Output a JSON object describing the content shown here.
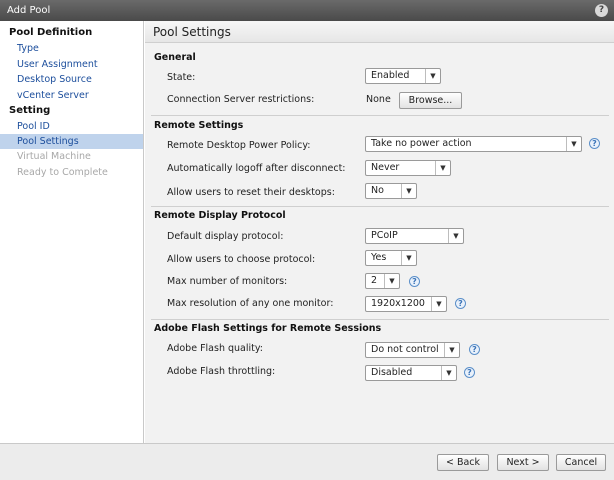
{
  "window": {
    "title": "Add Pool",
    "help": "?"
  },
  "sidebar": {
    "group1": "Pool Definition",
    "items1": [
      "Type",
      "User Assignment",
      "Desktop Source",
      "vCenter Server"
    ],
    "group2": "Setting",
    "items2": [
      "Pool ID",
      "Pool Settings",
      "Virtual Machine",
      "Ready to Complete"
    ]
  },
  "main": {
    "header": "Pool Settings",
    "general": {
      "title": "General",
      "state_label": "State:",
      "state_value": "Enabled",
      "conn_label": "Connection Server restrictions:",
      "conn_value": "None",
      "browse": "Browse..."
    },
    "remote": {
      "title": "Remote Settings",
      "power_label": "Remote Desktop Power Policy:",
      "power_value": "Take no power action",
      "logoff_label": "Automatically logoff after disconnect:",
      "logoff_value": "Never",
      "reset_label": "Allow users to reset their desktops:",
      "reset_value": "No"
    },
    "display": {
      "title": "Remote Display Protocol",
      "default_label": "Default display protocol:",
      "default_value": "PCoIP",
      "choose_label": "Allow users to choose protocol:",
      "choose_value": "Yes",
      "monitors_label": "Max number of monitors:",
      "monitors_value": "2",
      "resolution_label": "Max resolution of any one monitor:",
      "resolution_value": "1920x1200"
    },
    "flash": {
      "title": "Adobe Flash Settings for Remote Sessions",
      "quality_label": "Adobe Flash quality:",
      "quality_value": "Do not control",
      "throttle_label": "Adobe Flash throttling:",
      "throttle_value": "Disabled"
    }
  },
  "footer": {
    "back": "< Back",
    "next": "Next >",
    "cancel": "Cancel"
  }
}
